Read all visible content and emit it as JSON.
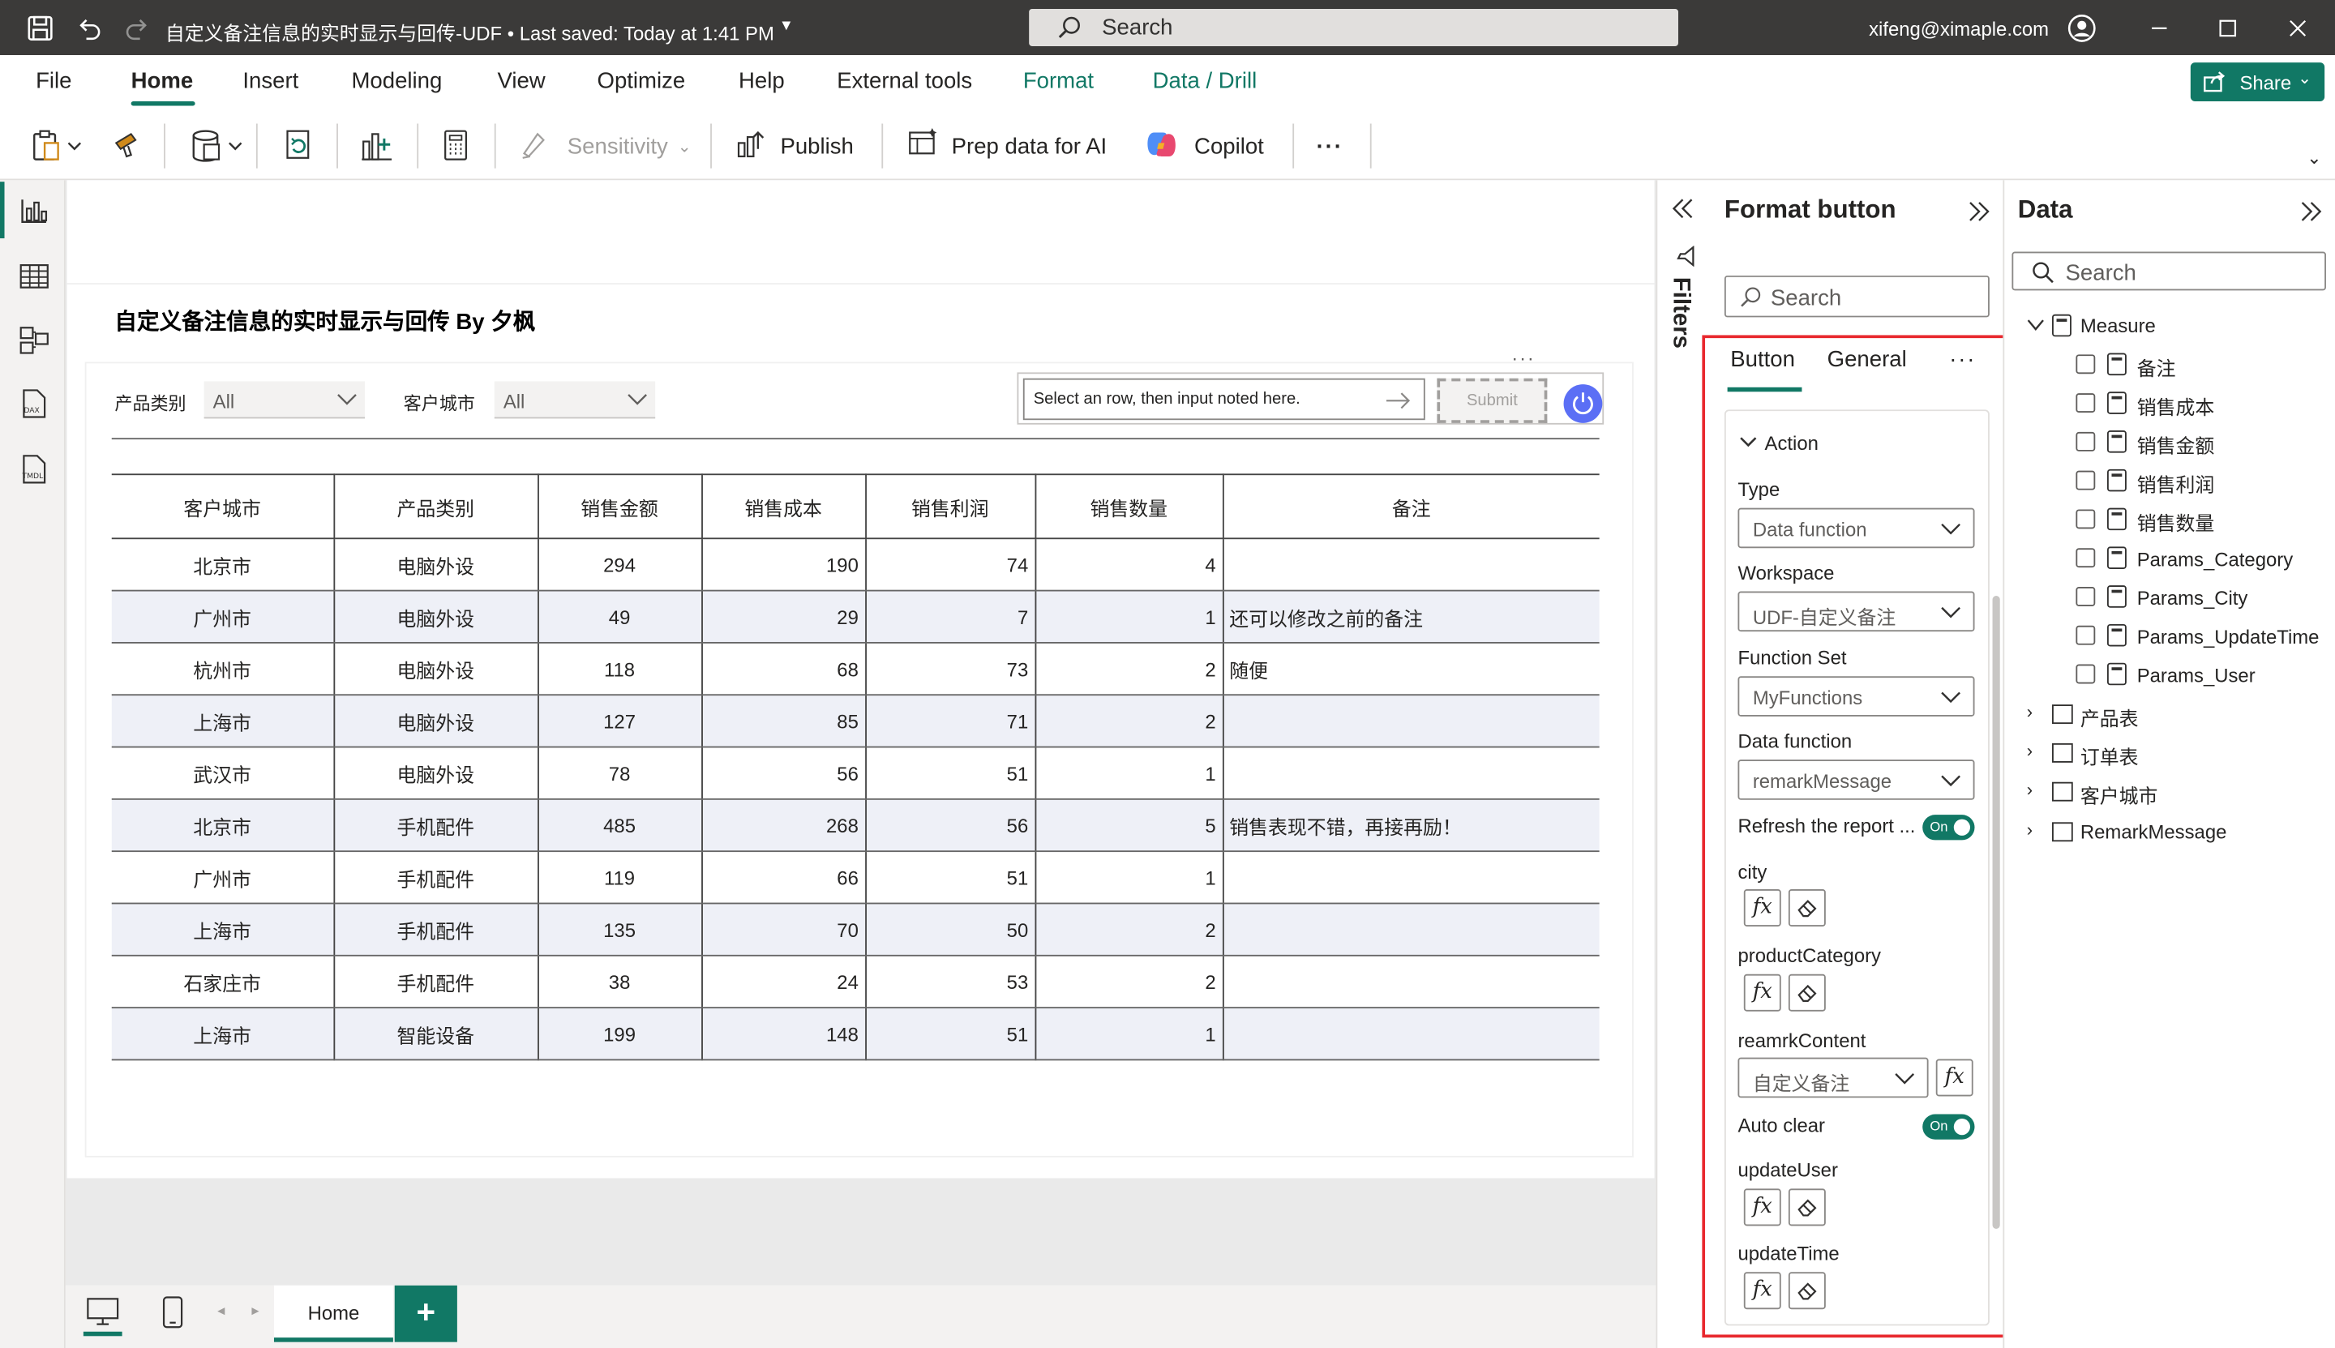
{
  "titlebar": {
    "doc_title": "自定义备注信息的实时显示与回传-UDF • Last saved: Today at 1:41 PM",
    "search_placeholder": "Search",
    "user_email": "xifeng@ximaple.com"
  },
  "ribbon": {
    "tabs": [
      "File",
      "Home",
      "Insert",
      "Modeling",
      "View",
      "Optimize",
      "Help",
      "External tools",
      "Format",
      "Data / Drill"
    ],
    "active_tab": "Home",
    "share_label": "Share",
    "toolbar": {
      "sensitivity": "Sensitivity",
      "publish": "Publish",
      "prep_data": "Prep data for AI",
      "copilot": "Copilot",
      "more": "···"
    }
  },
  "report": {
    "title": "自定义备注信息的实时显示与回传 By 夕枫",
    "slicers": [
      {
        "label": "产品类别",
        "value": "All"
      },
      {
        "label": "客户城市",
        "value": "All"
      }
    ],
    "remark_placeholder": "Select an row, then input noted here.",
    "submit_label": "Submit",
    "more": "···",
    "table": {
      "columns": [
        "客户城市",
        "产品类别",
        "销售金额",
        "销售成本",
        "销售利润",
        "销售数量",
        "备注"
      ],
      "rows": [
        [
          "北京市",
          "电脑外设",
          "294",
          "190",
          "74",
          "4",
          ""
        ],
        [
          "广州市",
          "电脑外设",
          "49",
          "29",
          "7",
          "1",
          "还可以修改之前的备注"
        ],
        [
          "杭州市",
          "电脑外设",
          "118",
          "68",
          "73",
          "2",
          "随便"
        ],
        [
          "上海市",
          "电脑外设",
          "127",
          "85",
          "71",
          "2",
          ""
        ],
        [
          "武汉市",
          "电脑外设",
          "78",
          "56",
          "51",
          "1",
          ""
        ],
        [
          "北京市",
          "手机配件",
          "485",
          "268",
          "56",
          "5",
          "销售表现不错，再接再励！"
        ],
        [
          "广州市",
          "手机配件",
          "119",
          "66",
          "51",
          "1",
          ""
        ],
        [
          "上海市",
          "手机配件",
          "135",
          "70",
          "50",
          "2",
          ""
        ],
        [
          "石家庄市",
          "手机配件",
          "38",
          "24",
          "53",
          "2",
          ""
        ],
        [
          "上海市",
          "智能设备",
          "199",
          "148",
          "51",
          "1",
          ""
        ]
      ]
    }
  },
  "bottombar": {
    "page_tab": "Home",
    "add_label": "+"
  },
  "filters": {
    "label": "Filters"
  },
  "format_pane": {
    "title": "Format button",
    "search_placeholder": "Search",
    "tabs": [
      "Button",
      "General"
    ],
    "more": "···",
    "section": "Action",
    "fields": {
      "type_label": "Type",
      "type_value": "Data function",
      "workspace_label": "Workspace",
      "workspace_value": "UDF-自定义备注",
      "function_set_label": "Function Set",
      "function_set_value": "MyFunctions",
      "data_function_label": "Data function",
      "data_function_value": "remarkMessage",
      "refresh_label": "Refresh the report ...",
      "refresh_toggle": "On",
      "city_label": "city",
      "product_label": "productCategory",
      "remark_label": "reamrkContent",
      "remark_value": "自定义备注",
      "autoclear_label": "Auto clear",
      "autoclear_toggle": "On",
      "updateuser_label": "updateUser",
      "updatetime_label": "updateTime",
      "fx": "fx"
    }
  },
  "data_pane": {
    "title": "Data",
    "search_placeholder": "Search",
    "measure_table": "Measure",
    "measures": [
      "备注",
      "销售成本",
      "销售金额",
      "销售利润",
      "销售数量",
      "Params_Category",
      "Params_City",
      "Params_UpdateTime",
      "Params_User"
    ],
    "tables": [
      "产品表",
      "订单表",
      "客户城市",
      "RemarkMessage"
    ]
  },
  "colors": {
    "accent": "#117865",
    "highlight": "#e8282e",
    "titlebar": "#3b3a39",
    "row_alt": "#eef0f7"
  }
}
